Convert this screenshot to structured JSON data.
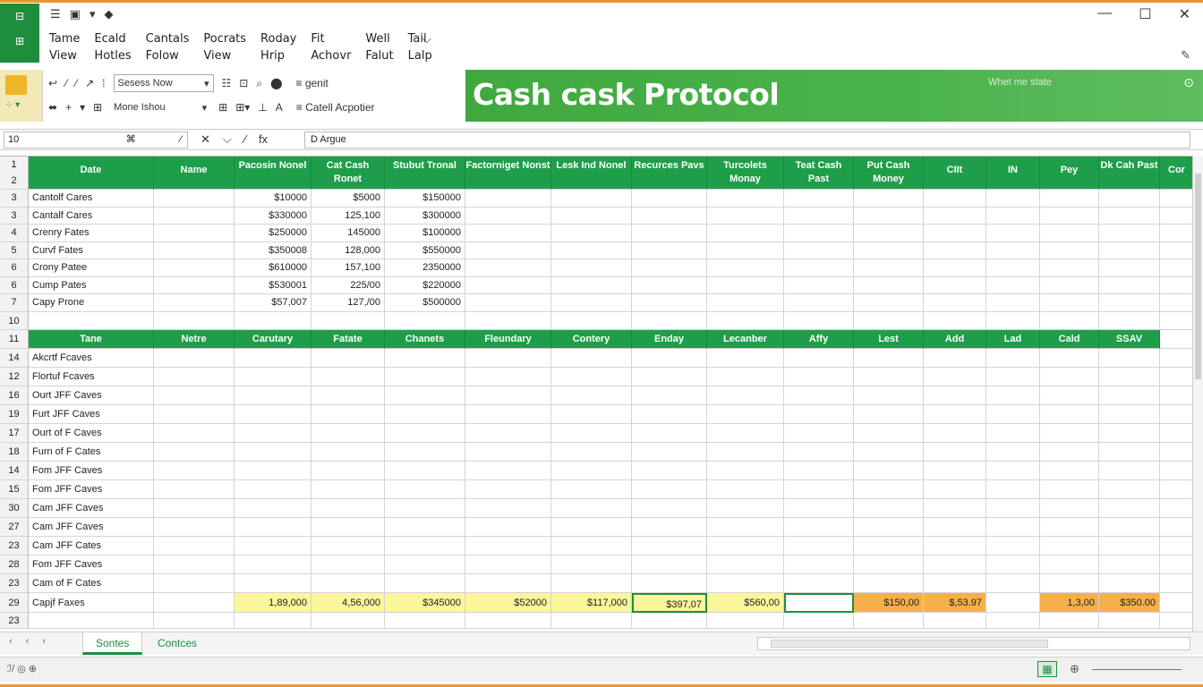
{
  "qat": [
    "☰",
    "▣",
    "▾",
    "◆"
  ],
  "window_controls": [
    "—",
    "☐",
    "✕"
  ],
  "menu": [
    "Tame",
    "Ecald",
    "Cantals",
    "Pocrats",
    "Roday",
    "Fit",
    "Well",
    "Tail",
    "⌵",
    "View",
    "Hotles",
    "Folow",
    "View",
    "Hrip",
    "Achovr",
    "Falut",
    "Lalp"
  ],
  "ribbon": {
    "row1": [
      "↩",
      "⁄",
      "⁄",
      "↗",
      "⁞"
    ],
    "combo1": "Sesess Now",
    "combo2": "Mone Ishou",
    "row1_end": [
      "☷",
      "⊡",
      "⌕",
      "⬤"
    ],
    "side1": "≡ genit",
    "side2": "≡ Catell Acpotier",
    "row2": [
      "⬌",
      "+",
      "▾",
      "⊞"
    ],
    "row2_end": [
      "⊞",
      "⊞▾",
      "⊥",
      "A"
    ]
  },
  "banner": {
    "title": "Cash cask Protocol",
    "search": "Whet me state",
    "close": "⊙"
  },
  "formula_bar": {
    "name_box": "10",
    "name_box_icon": "⌘",
    "name_box_end": "⁄",
    "buttons": [
      "✕",
      "⌵",
      "⁄",
      "fx"
    ],
    "content": "D Argue"
  },
  "table1": {
    "headers": [
      "Date",
      "Name",
      "Pacosin Nonel",
      "Cat Cash Ronet",
      "Stubut Tronal",
      "Factorniget Nonst",
      "Lesk Ind Nonel",
      "Recurces Pavs",
      "Turcolets Monay",
      "Teat Cash Past",
      "Put Cash Money",
      "CIIt",
      "IN",
      "Pey",
      "Dk Cah Past",
      "Cor"
    ],
    "rows": [
      {
        "n": "3",
        "date": "Cantolf Cares",
        "v1": "$10000",
        "v2": "$5000",
        "v3": "$150000"
      },
      {
        "n": "3",
        "date": "Cantalf Cares",
        "v1": "$330000",
        "v2": "125,100",
        "v3": "$300000"
      },
      {
        "n": "4",
        "date": "Crenry Fates",
        "v1": "$250000",
        "v2": "145000",
        "v3": "$100000"
      },
      {
        "n": "5",
        "date": "Curvf Fates",
        "v1": "$350008",
        "v2": "128,000",
        "v3": "$550000"
      },
      {
        "n": "6",
        "date": "Crony Patee",
        "v1": "$610000",
        "v2": "157,100",
        "v3": "2350000"
      },
      {
        "n": "6",
        "date": "Cump Pates",
        "v1": "$530001",
        "v2": "225/00",
        "v3": "$220000"
      },
      {
        "n": "7",
        "date": "Capy Prone",
        "v1": "$57,007",
        "v2": "127,/00",
        "v3": "$500000"
      }
    ]
  },
  "table2": {
    "headers": [
      "Tane",
      "Netre",
      "Carutary",
      "Fatate",
      "Chanets",
      "Fleundary",
      "Contery",
      "Enday",
      "Lecanber",
      "Affy",
      "Lest",
      "Add",
      "Lad",
      "Cald",
      "SSAV"
    ],
    "rows": [
      {
        "n": "14",
        "name": "Akcrtf Fcaves"
      },
      {
        "n": "12",
        "name": "Flortuf Fcaves"
      },
      {
        "n": "16",
        "name": "Ourt JFF Caves"
      },
      {
        "n": "19",
        "name": "Furt JFF Caves"
      },
      {
        "n": "17",
        "name": "Ourt of F Caves"
      },
      {
        "n": "18",
        "name": "Furn of F Cates"
      },
      {
        "n": "14",
        "name": "Fom JFF Caves"
      },
      {
        "n": "15",
        "name": "Fom JFF Caves"
      },
      {
        "n": "30",
        "name": "Cam JFF Caves"
      },
      {
        "n": "27",
        "name": "Cam JFF Caves"
      },
      {
        "n": "23",
        "name": "Cam JFF Cates"
      },
      {
        "n": "28",
        "name": "Fom JFF Caves"
      },
      {
        "n": "23",
        "name": "Cam of F Cates"
      }
    ],
    "total": {
      "n": "29",
      "name": "Capjf Faxes",
      "vals": [
        "1,89,000",
        "4,56,000",
        "$345000",
        "$52000",
        "$117,000",
        "$397,07",
        "$560,00",
        "",
        "$150,00",
        "$,53.97",
        "",
        "1,3,00",
        "$350.00"
      ]
    }
  },
  "row_labels": {
    "r1": "1",
    "r2": "2",
    "r10": "10",
    "r11": "11",
    "r23": "23"
  },
  "tabs": {
    "nav": "‹ ‹ ‹",
    "sheet1": "Sontes",
    "sheet2": "Contces"
  },
  "status": {
    "left": "ℐ/ ◎ ⊕",
    "view_icon": "▦",
    "zoom_icon": "⊕"
  },
  "colors": {
    "green": "#1e9e4a",
    "banner": "#4bb34b",
    "yellow": "#fbf59b",
    "orange": "#f5b04a",
    "frame": "#e8972b"
  }
}
